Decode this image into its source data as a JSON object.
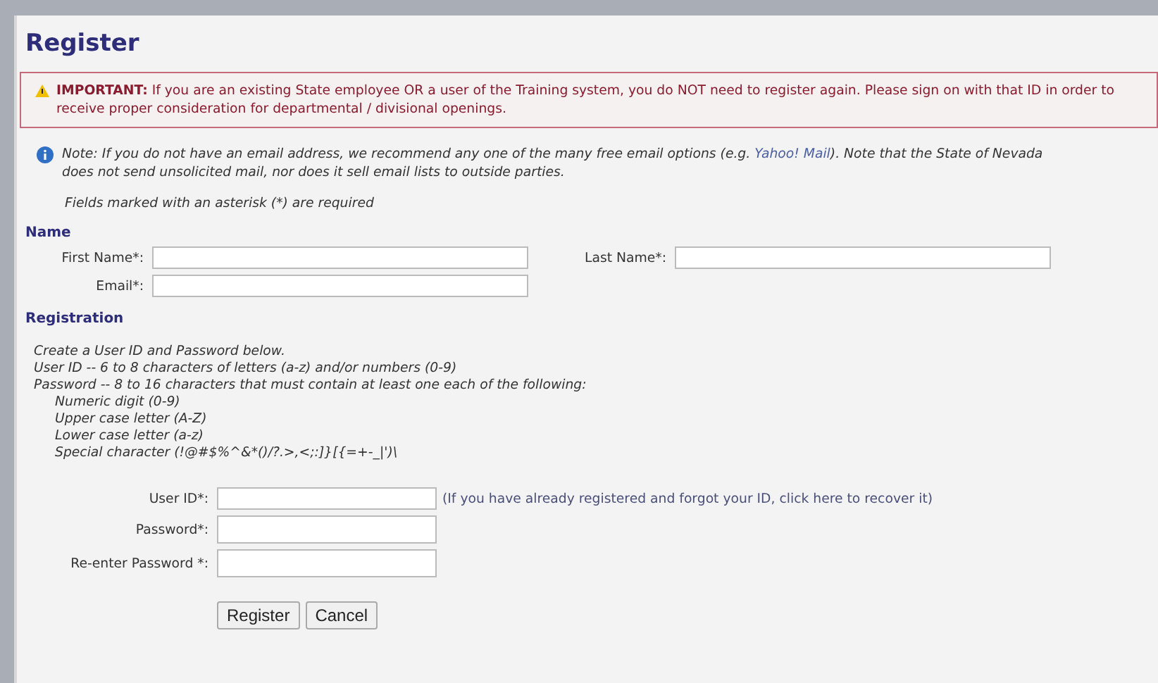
{
  "title": "Register",
  "alert": {
    "text": "**IMPORTANT:** If you are an existing State employee OR a user of the Training system, you do NOT need to register again. Please sign on with that ID in order to receive proper consideration for departmental / divisional openings."
  },
  "note": {
    "before": "Note: If you do not have an email address, we recommend any one of the many free email options (e.g. ",
    "link": "Yahoo! Mail",
    "after": "). Note that the State of Nevada does not send unsolicited mail, nor does it sell email lists to outside parties."
  },
  "required_note": "Fields marked with an asterisk (*) are required",
  "name_section": {
    "heading": "Name",
    "first_name": {
      "label": "First Name*:"
    },
    "last_name": {
      "label": "Last Name*:"
    },
    "email": {
      "label": "Email*:"
    }
  },
  "registration_section": {
    "heading": "Registration",
    "instructions": [
      "Create a User ID and Password below.",
      "User ID -- 6 to 8 characters of letters (a-z) and/or numbers (0-9)",
      "Password -- 8 to 16 characters that must contain at least one each of the following:"
    ],
    "password_rules": [
      "Numeric digit (0-9)",
      "Upper case letter (A-Z)",
      "Lower case letter (a-z)",
      "Special character (!@#$%^&*()/?.>,<;:]}[{=+-_|')\\"
    ],
    "user_id": {
      "label": "User ID*:",
      "hint": "(If you have already registered and forgot your ID, click here to recover it)"
    },
    "password": {
      "label": "Password*:"
    },
    "confirm_password": {
      "label": "Re-enter Password *:"
    }
  },
  "buttons": [
    "Register",
    "Cancel"
  ]
}
